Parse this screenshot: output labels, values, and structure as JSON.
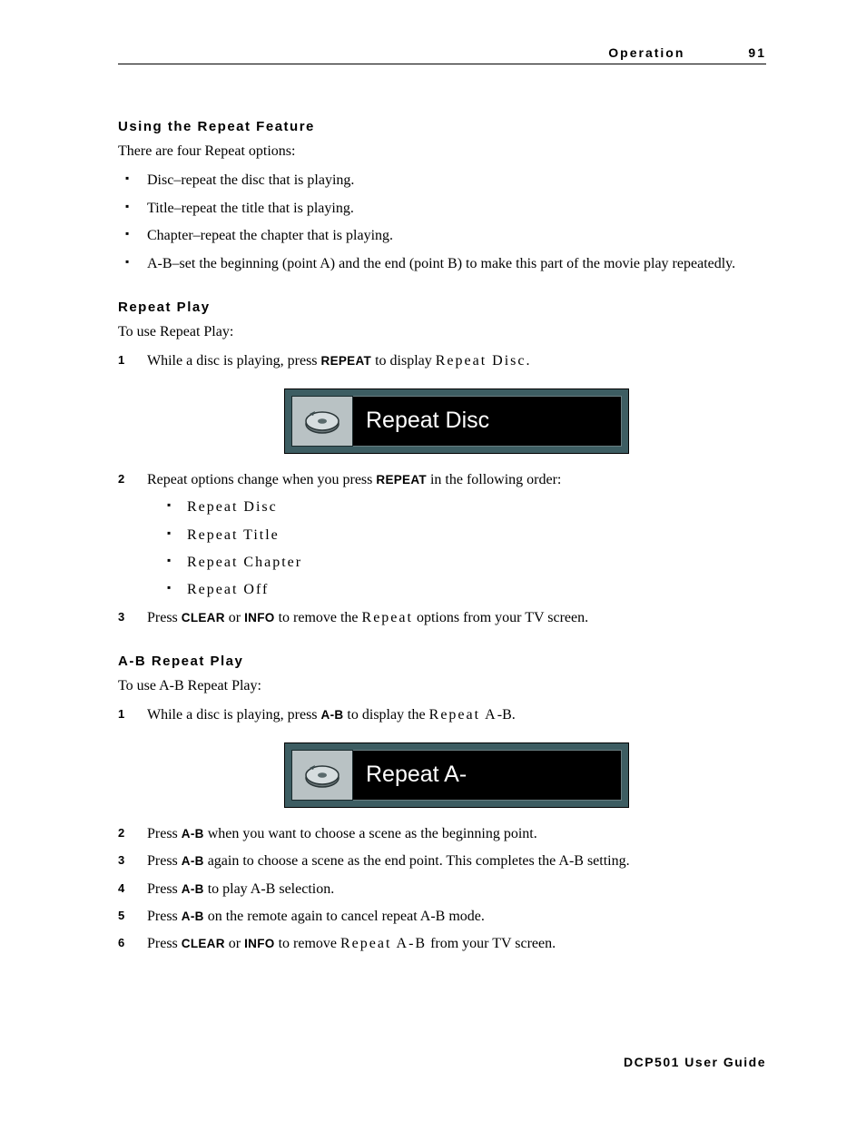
{
  "header": {
    "section": "Operation",
    "page": "91"
  },
  "section1": {
    "heading": "Using the Repeat Feature",
    "intro": "There are four Repeat options:",
    "bullets": [
      "Disc–repeat the disc that is playing.",
      "Title–repeat the title that is playing.",
      "Chapter–repeat the chapter that is playing.",
      "A-B–set the beginning (point A) and the end (point B) to make this part of the movie play repeatedly."
    ]
  },
  "section2": {
    "heading": "Repeat Play",
    "intro": "To use Repeat Play:",
    "step1_a": "While a disc is playing, press ",
    "step1_key": "REPEAT",
    "step1_b": " to display ",
    "step1_osd": "Repeat Disc",
    "step1_c": ".",
    "osd_label": "Repeat Disc",
    "step2_a": "Repeat options change when you press ",
    "step2_key": "REPEAT",
    "step2_b": " in the following order:",
    "options": [
      "Repeat Disc",
      "Repeat Title",
      "Repeat Chapter",
      "Repeat Off"
    ],
    "step3_a": "Press ",
    "step3_key1": "CLEAR",
    "step3_or": " or ",
    "step3_key2": "INFO",
    "step3_b": " to remove the ",
    "step3_osd": "Repeat",
    "step3_c": " options from your TV screen."
  },
  "section3": {
    "heading": "A-B Repeat Play",
    "intro": "To use A-B Repeat Play:",
    "step1_a": "While a disc is playing, press ",
    "step1_key": "A-B",
    "step1_b": " to display the ",
    "step1_osd": "Repeat A",
    "step1_c": "-B.",
    "osd_label": "Repeat A-",
    "step2_a": "Press ",
    "step2_key": "A-B",
    "step2_b": " when you want to choose a scene as the beginning point.",
    "step3_a": "Press ",
    "step3_key": "A-B",
    "step3_b": " again to choose a scene as the end point. This completes the A-B setting.",
    "step4_a": "Press ",
    "step4_key": "A-B",
    "step4_b": " to play A-B selection.",
    "step5_a": "Press ",
    "step5_key": "A-B",
    "step5_b": " on the remote again to cancel repeat A-B mode.",
    "step6_a": "Press ",
    "step6_key1": "CLEAR",
    "step6_or": " or ",
    "step6_key2": "INFO",
    "step6_b": " to remove ",
    "step6_osd": "Repeat A-B",
    "step6_c": " from your TV screen."
  },
  "footer": "DCP501 User Guide"
}
